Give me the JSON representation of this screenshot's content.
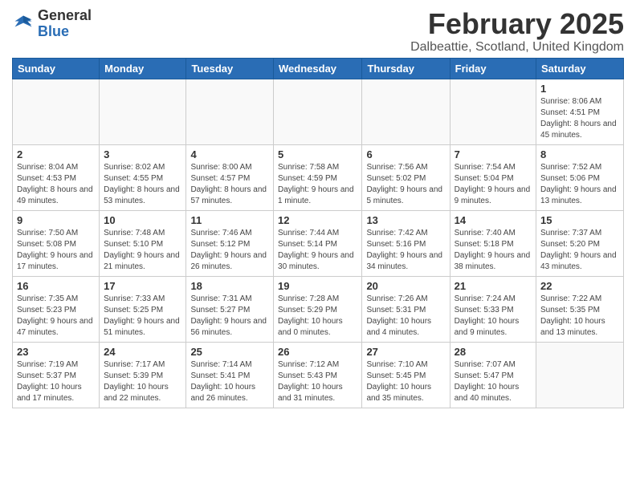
{
  "header": {
    "logo_line1": "General",
    "logo_line2": "Blue",
    "title": "February 2025",
    "location": "Dalbeattie, Scotland, United Kingdom"
  },
  "weekdays": [
    "Sunday",
    "Monday",
    "Tuesday",
    "Wednesday",
    "Thursday",
    "Friday",
    "Saturday"
  ],
  "weeks": [
    [
      {
        "day": "",
        "info": ""
      },
      {
        "day": "",
        "info": ""
      },
      {
        "day": "",
        "info": ""
      },
      {
        "day": "",
        "info": ""
      },
      {
        "day": "",
        "info": ""
      },
      {
        "day": "",
        "info": ""
      },
      {
        "day": "1",
        "info": "Sunrise: 8:06 AM\nSunset: 4:51 PM\nDaylight: 8 hours and 45 minutes."
      }
    ],
    [
      {
        "day": "2",
        "info": "Sunrise: 8:04 AM\nSunset: 4:53 PM\nDaylight: 8 hours and 49 minutes."
      },
      {
        "day": "3",
        "info": "Sunrise: 8:02 AM\nSunset: 4:55 PM\nDaylight: 8 hours and 53 minutes."
      },
      {
        "day": "4",
        "info": "Sunrise: 8:00 AM\nSunset: 4:57 PM\nDaylight: 8 hours and 57 minutes."
      },
      {
        "day": "5",
        "info": "Sunrise: 7:58 AM\nSunset: 4:59 PM\nDaylight: 9 hours and 1 minute."
      },
      {
        "day": "6",
        "info": "Sunrise: 7:56 AM\nSunset: 5:02 PM\nDaylight: 9 hours and 5 minutes."
      },
      {
        "day": "7",
        "info": "Sunrise: 7:54 AM\nSunset: 5:04 PM\nDaylight: 9 hours and 9 minutes."
      },
      {
        "day": "8",
        "info": "Sunrise: 7:52 AM\nSunset: 5:06 PM\nDaylight: 9 hours and 13 minutes."
      }
    ],
    [
      {
        "day": "9",
        "info": "Sunrise: 7:50 AM\nSunset: 5:08 PM\nDaylight: 9 hours and 17 minutes."
      },
      {
        "day": "10",
        "info": "Sunrise: 7:48 AM\nSunset: 5:10 PM\nDaylight: 9 hours and 21 minutes."
      },
      {
        "day": "11",
        "info": "Sunrise: 7:46 AM\nSunset: 5:12 PM\nDaylight: 9 hours and 26 minutes."
      },
      {
        "day": "12",
        "info": "Sunrise: 7:44 AM\nSunset: 5:14 PM\nDaylight: 9 hours and 30 minutes."
      },
      {
        "day": "13",
        "info": "Sunrise: 7:42 AM\nSunset: 5:16 PM\nDaylight: 9 hours and 34 minutes."
      },
      {
        "day": "14",
        "info": "Sunrise: 7:40 AM\nSunset: 5:18 PM\nDaylight: 9 hours and 38 minutes."
      },
      {
        "day": "15",
        "info": "Sunrise: 7:37 AM\nSunset: 5:20 PM\nDaylight: 9 hours and 43 minutes."
      }
    ],
    [
      {
        "day": "16",
        "info": "Sunrise: 7:35 AM\nSunset: 5:23 PM\nDaylight: 9 hours and 47 minutes."
      },
      {
        "day": "17",
        "info": "Sunrise: 7:33 AM\nSunset: 5:25 PM\nDaylight: 9 hours and 51 minutes."
      },
      {
        "day": "18",
        "info": "Sunrise: 7:31 AM\nSunset: 5:27 PM\nDaylight: 9 hours and 56 minutes."
      },
      {
        "day": "19",
        "info": "Sunrise: 7:28 AM\nSunset: 5:29 PM\nDaylight: 10 hours and 0 minutes."
      },
      {
        "day": "20",
        "info": "Sunrise: 7:26 AM\nSunset: 5:31 PM\nDaylight: 10 hours and 4 minutes."
      },
      {
        "day": "21",
        "info": "Sunrise: 7:24 AM\nSunset: 5:33 PM\nDaylight: 10 hours and 9 minutes."
      },
      {
        "day": "22",
        "info": "Sunrise: 7:22 AM\nSunset: 5:35 PM\nDaylight: 10 hours and 13 minutes."
      }
    ],
    [
      {
        "day": "23",
        "info": "Sunrise: 7:19 AM\nSunset: 5:37 PM\nDaylight: 10 hours and 17 minutes."
      },
      {
        "day": "24",
        "info": "Sunrise: 7:17 AM\nSunset: 5:39 PM\nDaylight: 10 hours and 22 minutes."
      },
      {
        "day": "25",
        "info": "Sunrise: 7:14 AM\nSunset: 5:41 PM\nDaylight: 10 hours and 26 minutes."
      },
      {
        "day": "26",
        "info": "Sunrise: 7:12 AM\nSunset: 5:43 PM\nDaylight: 10 hours and 31 minutes."
      },
      {
        "day": "27",
        "info": "Sunrise: 7:10 AM\nSunset: 5:45 PM\nDaylight: 10 hours and 35 minutes."
      },
      {
        "day": "28",
        "info": "Sunrise: 7:07 AM\nSunset: 5:47 PM\nDaylight: 10 hours and 40 minutes."
      },
      {
        "day": "",
        "info": ""
      }
    ]
  ]
}
